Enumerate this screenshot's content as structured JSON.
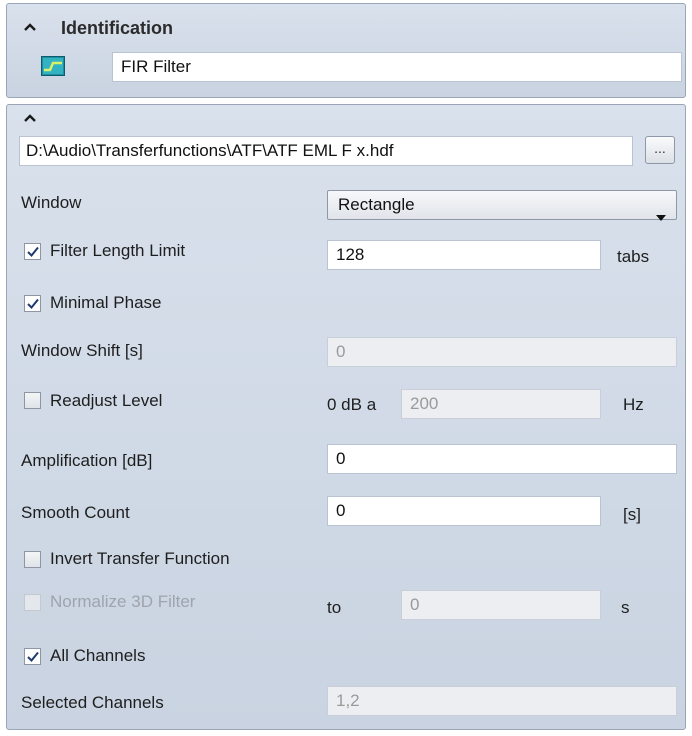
{
  "identification": {
    "title": "Identification",
    "name_value": "FIR Filter"
  },
  "params": {
    "file_path": "D:\\Audio\\Transferfunctions\\ATF\\ATF EML F x.hdf",
    "browse_label": "...",
    "window_label": "Window",
    "window_value": "Rectangle",
    "filter_length_limit_label": "Filter Length Limit",
    "filter_length_limit_checked": true,
    "filter_length_value": "128",
    "filter_length_unit": "tabs",
    "minimal_phase_label": "Minimal Phase",
    "minimal_phase_checked": true,
    "window_shift_label": "Window Shift [s]",
    "window_shift_value": "0",
    "readjust_level_label": "Readjust Level",
    "readjust_level_checked": false,
    "readjust_prefix": "0 dB a",
    "readjust_value": "200",
    "readjust_unit": "Hz",
    "amplification_label": "Amplification [dB]",
    "amplification_value": "0",
    "smooth_count_label": "Smooth Count",
    "smooth_count_value": "0",
    "smooth_count_unit": "[s]",
    "invert_label": "Invert Transfer Function",
    "invert_checked": false,
    "normalize_label": "Normalize 3D Filter",
    "normalize_checked": false,
    "normalize_to_label": "to",
    "normalize_value": "0",
    "normalize_unit": "s",
    "all_channels_label": "All Channels",
    "all_channels_checked": true,
    "selected_channels_label": "Selected Channels",
    "selected_channels_value": "1,2"
  },
  "icons": {
    "collapse": "chevron-up-icon",
    "filter": "filter-icon",
    "dropdown": "caret-down-icon",
    "check": "check-icon"
  }
}
